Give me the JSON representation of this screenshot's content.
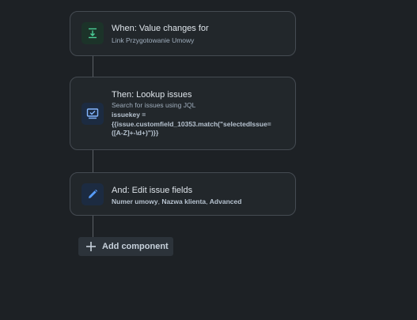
{
  "trigger": {
    "title": "When: Value changes for",
    "subtitle": "Link Przygotowanie Umowy",
    "icon": "field-value-changed-icon",
    "color": "#1f845a"
  },
  "lookup": {
    "title": "Then: Lookup issues",
    "subtitle": "Search for issues using JQL",
    "jql_line1": "issuekey =",
    "jql_line2": "{{issue.customfield_10353.match(\"selectedIssue=",
    "jql_line3": "([A-Z]+-\\d+)\")}}",
    "icon": "lookup-issues-icon",
    "color": "#579dff"
  },
  "edit": {
    "title": "And: Edit issue fields",
    "field1": "Numer umowy",
    "sep1": ", ",
    "field2": "Nazwa klienta",
    "sep2": ", ",
    "field3": "Advanced",
    "icon": "pencil-icon",
    "color": "#579dff"
  },
  "add_component": {
    "label": "Add component",
    "icon": "plus-icon"
  }
}
